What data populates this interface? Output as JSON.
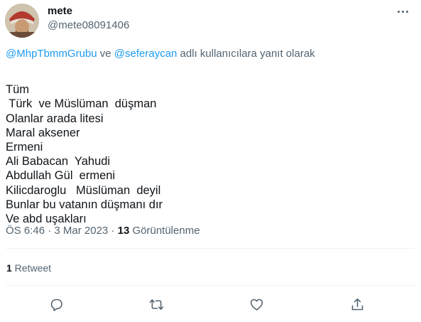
{
  "author": {
    "name": "mete",
    "handle": "@mete08091406"
  },
  "reply": {
    "mention1": "@MhpTbmmGrubu",
    "conjunction": " ve ",
    "mention2": "@seferaycan",
    "suffix": " adlı kullanıcılara yanıt olarak"
  },
  "tweet": {
    "lines": [
      "Tüm",
      " Türk  ve Müslüman  düşman",
      "Olanlar arada litesi",
      "Maral aksener",
      "Ermeni",
      "Ali Babacan  Yahudi",
      "Abdullah Gül  ermeni",
      "Kilicdaroglu   Müslüman  deyil",
      "Bunlar bu vatanın düşmanı dır",
      "Ve abd uşakları"
    ]
  },
  "meta": {
    "time": "ÖS 6:46",
    "sep1": " · ",
    "date": "3 Mar 2023",
    "sep2": " · ",
    "views_count": "13",
    "views_label": " Görüntülenme"
  },
  "stats": {
    "retweets_count": "1",
    "retweets_label": " Retweet"
  },
  "icons": {
    "more": "more-horizontal-icon",
    "reply": "reply-icon",
    "retweet": "retweet-icon",
    "like": "heart-icon",
    "share": "share-icon"
  },
  "colors": {
    "link": "#1d9bf0",
    "secondary_text": "#536471",
    "primary_text": "#0f1419",
    "divider": "#eff3f4"
  }
}
